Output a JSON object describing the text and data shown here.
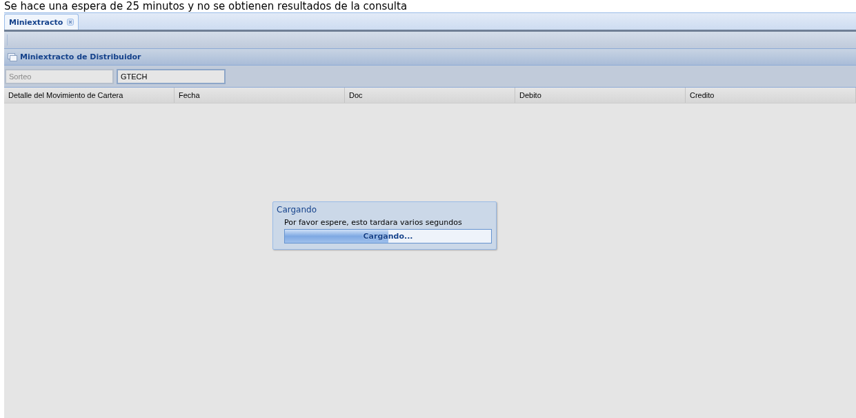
{
  "caption": "Se hace una espera de 25 minutos y no se obtienen resultados de la consulta",
  "tabs": [
    {
      "label": "Miniextracto",
      "selected": true,
      "closable": true
    }
  ],
  "panel": {
    "title": "Miniextracto de Distribuidor"
  },
  "filters": [
    {
      "placeholder": "Sorteo"
    },
    {
      "value": "GTECH"
    }
  ],
  "table": {
    "columns": [
      "Detalle del Movimiento de Cartera",
      "Fecha",
      "Doc",
      "Debito",
      "Credito"
    ]
  },
  "dialog": {
    "title": "Cargando",
    "message": "Por favor espere, esto tardara varios segundos",
    "progress": {
      "level": 0.5,
      "text": "Cargando..."
    }
  }
}
